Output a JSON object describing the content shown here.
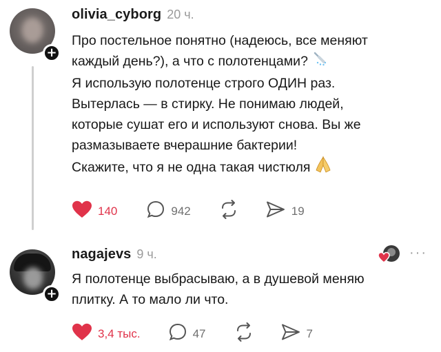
{
  "comments": [
    {
      "username": "olivia_cyborg",
      "time": "20 ч.",
      "lines": [
        "Про постельное понятно (надеюсь, все меняют",
        "каждый день?), а что с полотенцами?",
        "Я использую полотенце строго ОДИН раз.",
        "Вытерлась — в стирку. Не понимаю людей,",
        "которые сушат его и используют снова. Вы же",
        "размазываете вчерашние бактерии!",
        "Скажите, что я не одна такая чистюля"
      ],
      "line2_emoji": "shower-icon",
      "line7_emoji": "praying-hands-icon",
      "likes": "140",
      "replies": "942",
      "reposts": "",
      "shares": "19"
    },
    {
      "username": "nagajevs",
      "time": "9 ч.",
      "lines": [
        "Я полотенце выбрасываю, а в душевой меняю",
        "плитку. А то мало ли что."
      ],
      "likes": "3,4 тыс.",
      "replies": "47",
      "reposts": "",
      "shares": "7",
      "more": "···"
    }
  ],
  "colors": {
    "like": "#e0334a",
    "muted": "#6f6f6f",
    "thread_line": "#cfcfcf"
  },
  "icons": [
    "heart-icon",
    "comment-icon",
    "repost-icon",
    "share-icon",
    "plus-icon",
    "more-icon"
  ]
}
